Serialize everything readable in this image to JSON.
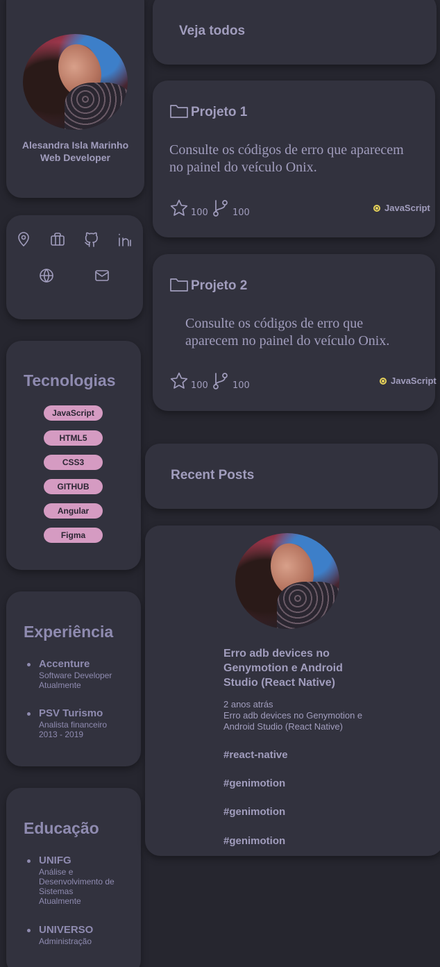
{
  "profile": {
    "name": "Alesandra Isla Marinho",
    "role": "Web Developer"
  },
  "links": {
    "icons": [
      "location-icon",
      "briefcase-icon",
      "github-icon",
      "linkedin-icon",
      "globe-icon",
      "mail-icon"
    ]
  },
  "technologies": {
    "title": "Tecnologias",
    "tags": [
      "JavaScript",
      "HTML5",
      "CSS3",
      "GITHUB",
      "Angular",
      "Figma"
    ]
  },
  "experience": {
    "title": "Experiência",
    "items": [
      {
        "name": "Accenture",
        "lines": [
          "Software Developer",
          "Atualmente"
        ]
      },
      {
        "name": "PSV Turismo",
        "lines": [
          "Analista financeiro",
          "2013 - 2019"
        ]
      }
    ]
  },
  "education": {
    "title": "Educação",
    "items": [
      {
        "name": "UNIFG",
        "lines": [
          "Análise e",
          "Desenvolvimento de",
          "Sistemas",
          "Atualmente"
        ]
      },
      {
        "name": "UNIVERSO",
        "lines": [
          "Administração"
        ]
      }
    ]
  },
  "repos": {
    "see_all": "Veja todos",
    "projects": [
      {
        "name": "Projeto 1",
        "description_lines": [
          "Consulte os códigos de erro que aparecem",
          "no painel do veículo Onix."
        ],
        "stars": "100",
        "forks": "100",
        "language": "JavaScript"
      },
      {
        "name": "Projeto 2",
        "description_lines": [
          "Consulte os códigos de erro que",
          "aparecem no painel do veículo Onix."
        ],
        "stars": "100",
        "forks": "100",
        "language": "JavaScript"
      }
    ]
  },
  "posts": {
    "title": "Recent Posts",
    "items": [
      {
        "title_lines": [
          "Erro adb devices no",
          "Genymotion e Android",
          "Studio (React Native)"
        ],
        "time": "2 anos atrás",
        "excerpt_lines": [
          "Erro adb devices no Genymotion e",
          "Android Studio (React Native)"
        ],
        "tags": [
          "#react-native",
          "#genimotion",
          "#genimotion",
          "#genimotion"
        ]
      }
    ]
  },
  "colors": {
    "background": "#26262f",
    "card": "#32323e",
    "text": "#a19dbd",
    "tag": "#d59bc2",
    "language_dot": "#e8d35a"
  }
}
